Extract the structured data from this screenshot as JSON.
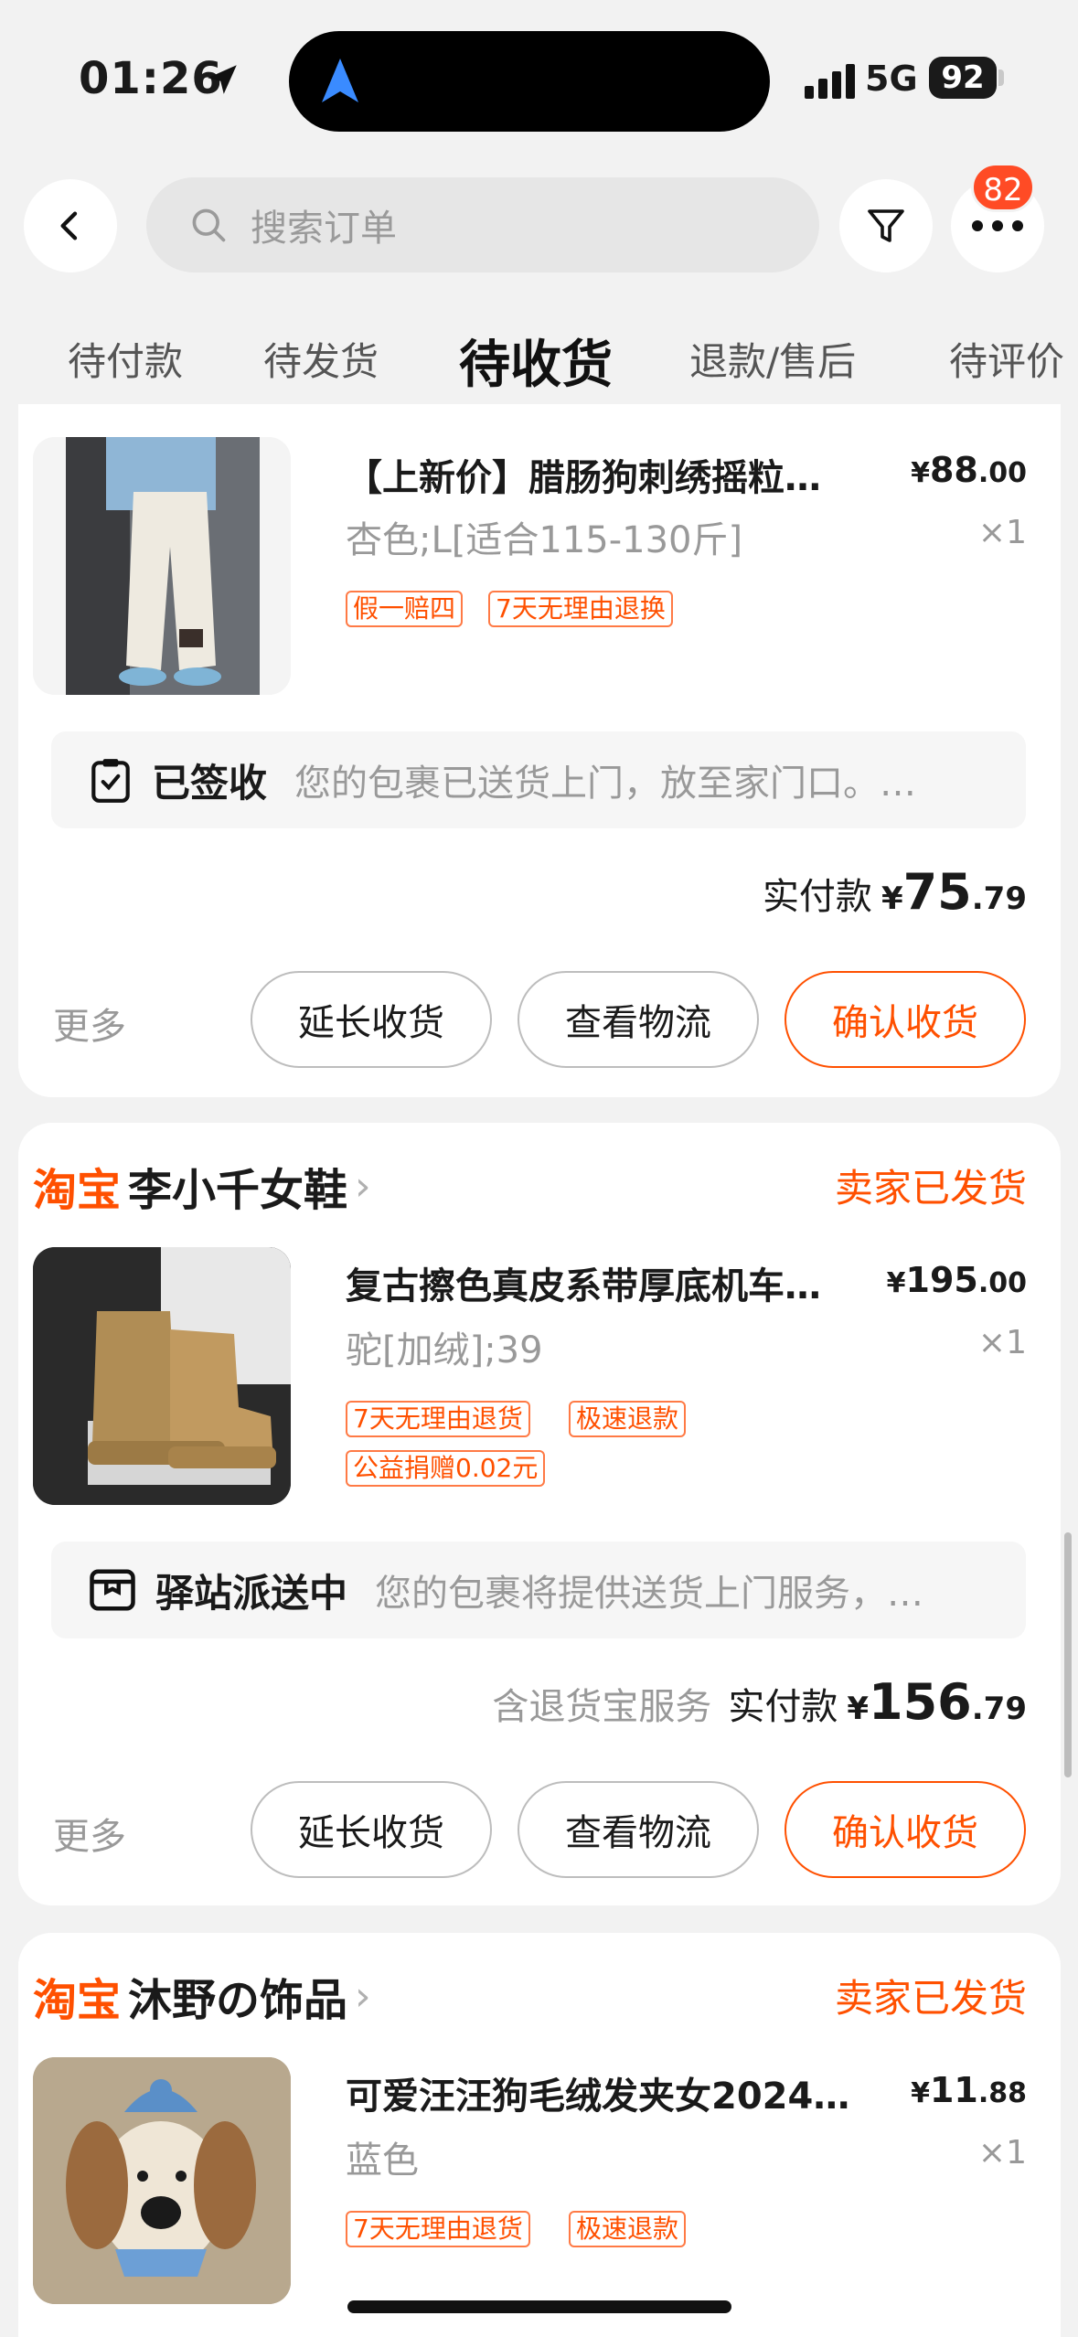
{
  "status_bar": {
    "time": "01:26",
    "network": "5G",
    "battery": "92"
  },
  "header": {
    "search_placeholder": "搜索订单",
    "more_badge": "82",
    "tabs": [
      {
        "label": "待付款"
      },
      {
        "label": "待发货"
      },
      {
        "label": "待收货",
        "active": true
      },
      {
        "label": "退款/售后"
      },
      {
        "label": "待评价"
      }
    ]
  },
  "orders": [
    {
      "item": {
        "title": "【上新价】腊肠狗刺绣摇粒…",
        "sku": "杏色;L[适合115-130斤]",
        "price_int": "88",
        "price_dec": ".00",
        "qty": "×1",
        "tags": [
          "假一赔四",
          "7天无理由退换"
        ]
      },
      "logistics": {
        "status": "已签收",
        "detail": "您的包裹已送货上门，放至家门口。…"
      },
      "paid": {
        "label": "实付款",
        "int": "75",
        "dec": ".79"
      },
      "actions": {
        "more": "更多",
        "extend": "延长收货",
        "track": "查看物流",
        "confirm": "确认收货"
      }
    },
    {
      "shop": {
        "platform": "淘宝",
        "name": "李小千女鞋",
        "status": "卖家已发货"
      },
      "item": {
        "title": "复古擦色真皮系带厚底机车…",
        "sku": "驼[加绒];39",
        "price_int": "195",
        "price_dec": ".00",
        "qty": "×1",
        "tags": [
          "7天无理由退货",
          "极速退款",
          "公益捐赠0.02元"
        ]
      },
      "logistics": {
        "status": "驿站派送中",
        "detail": "您的包裹将提供送货上门服务，…"
      },
      "paid": {
        "note": "含退货宝服务",
        "label": "实付款",
        "int": "156",
        "dec": ".79"
      },
      "actions": {
        "more": "更多",
        "extend": "延长收货",
        "track": "查看物流",
        "confirm": "确认收货"
      }
    },
    {
      "shop": {
        "platform": "淘宝",
        "name": "沐野の饰品",
        "status": "卖家已发货"
      },
      "item": {
        "title": "可爱汪汪狗毛绒发夹女2024…",
        "sku": "蓝色",
        "price_int": "11",
        "price_dec": ".88",
        "qty": "×1",
        "tags": [
          "7天无理由退货",
          "极速退款"
        ]
      }
    }
  ],
  "currency": "¥",
  "colors": {
    "accent": "#ff5000",
    "badge": "#ff4b25",
    "background": "#f2f2f2"
  }
}
